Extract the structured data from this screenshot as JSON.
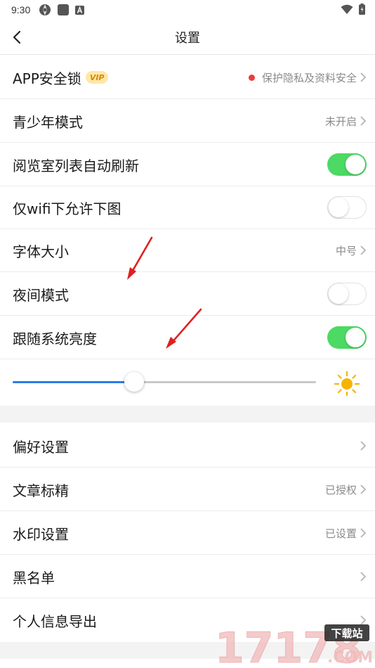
{
  "status_bar": {
    "time": "9:30"
  },
  "nav": {
    "title": "设置"
  },
  "rows_group1": [
    {
      "label": "APP安全锁",
      "badge": "VIP",
      "value": "保护隐私及资料安全"
    },
    {
      "label": "青少年模式",
      "value": "未开启"
    },
    {
      "label": "阅览室列表自动刷新",
      "toggle": true
    },
    {
      "label": "仅wifi下允许下图",
      "toggle": false
    },
    {
      "label": "字体大小",
      "value": "中号"
    },
    {
      "label": "夜间模式",
      "toggle": false
    },
    {
      "label": "跟随系统亮度",
      "toggle": true
    }
  ],
  "brightness": {
    "level": 0.4
  },
  "rows_group2": [
    {
      "label": "偏好设置",
      "value": ""
    },
    {
      "label": "文章标精",
      "value": "已授权"
    },
    {
      "label": "水印设置",
      "value": "已设置"
    },
    {
      "label": "黑名单",
      "value": ""
    },
    {
      "label": "个人信息导出",
      "value": ""
    }
  ],
  "watermark": {
    "number": "17178",
    "badge": "下载站",
    "domain": ".COM"
  },
  "colors": {
    "toggle_on": "#4cd964",
    "slider": "#2c7be5",
    "vip_bg": "#ffe7a8",
    "vip_text": "#d48a00",
    "red_dot": "#ee3b3b",
    "arrow": "#e02020"
  }
}
